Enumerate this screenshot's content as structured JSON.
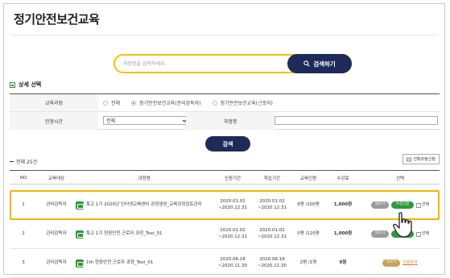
{
  "page": {
    "title": "정기안전보건교육"
  },
  "search": {
    "placeholder": "과정명을 입력하세요.",
    "button_label": "검색하기"
  },
  "detail": {
    "heading": "상세 선택",
    "rows": [
      {
        "label": "교육과정",
        "options": [
          "전체",
          "정기안전보건교육(관리감독자)",
          "정기안전보건교육(근로자)"
        ],
        "selected_index": 1
      },
      {
        "label": "인정시간",
        "select_value": "전체",
        "second_label": "과정명",
        "second_value": ""
      }
    ],
    "query_button": "검색"
  },
  "list": {
    "total_label": "전체 25건",
    "apply_button": "선택과정신청",
    "headers": [
      "NO",
      "교육대상",
      "과정명",
      "신청기간",
      "학습기간",
      "교육인원",
      "수강료",
      "선택"
    ],
    "rows": [
      {
        "no": "1",
        "target": "관리감독자",
        "course": "특고 1기 2020년 인터넷교육센터 과정생성_교육과정검토관리",
        "apply_period": "2020.01.02 ~2020.12.31",
        "study_period": "2020.01.02 ~2020.12.31",
        "people": "9명 /100명",
        "fee": "1,000원",
        "actions": [
          "맛보기",
          "수강신청",
          "선택"
        ]
      },
      {
        "no": "2",
        "target": "관리감독자",
        "course": "특고 1기 현장안전 근로자 과정_Test_01",
        "apply_period": "2020.01.02 ~2020.12.31",
        "study_period": "2020.01.02 ~2020.12.31",
        "people": "0명 /120명",
        "fee": "1,000원",
        "actions": [
          "맛보기",
          "수강신청",
          "선택"
        ]
      },
      {
        "no": "3",
        "target": "관리감독자",
        "course": "1th 현장안전 근로자 과정_Test_01",
        "apply_period": "2020.06.18 ~2020.11.30",
        "study_period": "2020.06.18 ~2020.11.30",
        "people": "2명 /1명",
        "fee": "0원",
        "actions": [
          "맛보기",
          "인원초과"
        ]
      }
    ]
  },
  "icons": {
    "search": "search-icon",
    "section": "section-icon",
    "course": "course-icon",
    "apply": "apply-cart-icon",
    "pointer": "hand-pointer-icon"
  },
  "colors": {
    "navy": "#1f2a5a",
    "highlight": "#f2b400",
    "green": "#2e9a3c",
    "orange": "#e07a1a"
  }
}
